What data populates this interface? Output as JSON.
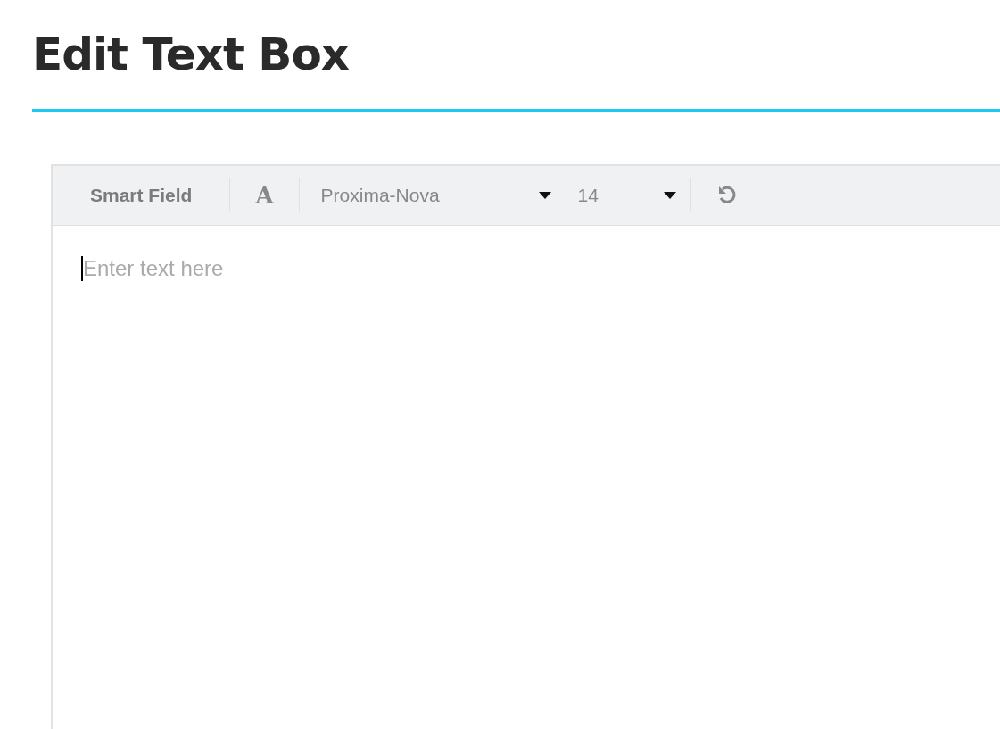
{
  "title": "Edit Text Box",
  "toolbar": {
    "smart_field": "Smart Field",
    "font_color": "A",
    "font_family": "Proxima-Nova",
    "font_size": "14"
  },
  "editor": {
    "placeholder": "Enter text here"
  }
}
